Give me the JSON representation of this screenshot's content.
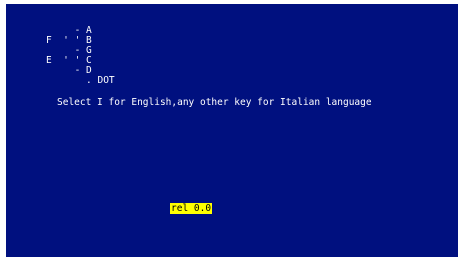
{
  "colors": {
    "background": "#00107f",
    "text": "#ffffff",
    "highlight_bg": "#ffff00",
    "highlight_text": "#000000"
  },
  "segment_diagram": {
    "lines": [
      "     - A",
      "F  ' ' B",
      "     - G",
      "E  ' ' C",
      "     - D",
      "       . DOT"
    ]
  },
  "prompt": "Select I for English,any other key for Italian language",
  "release": "rel 0.0"
}
